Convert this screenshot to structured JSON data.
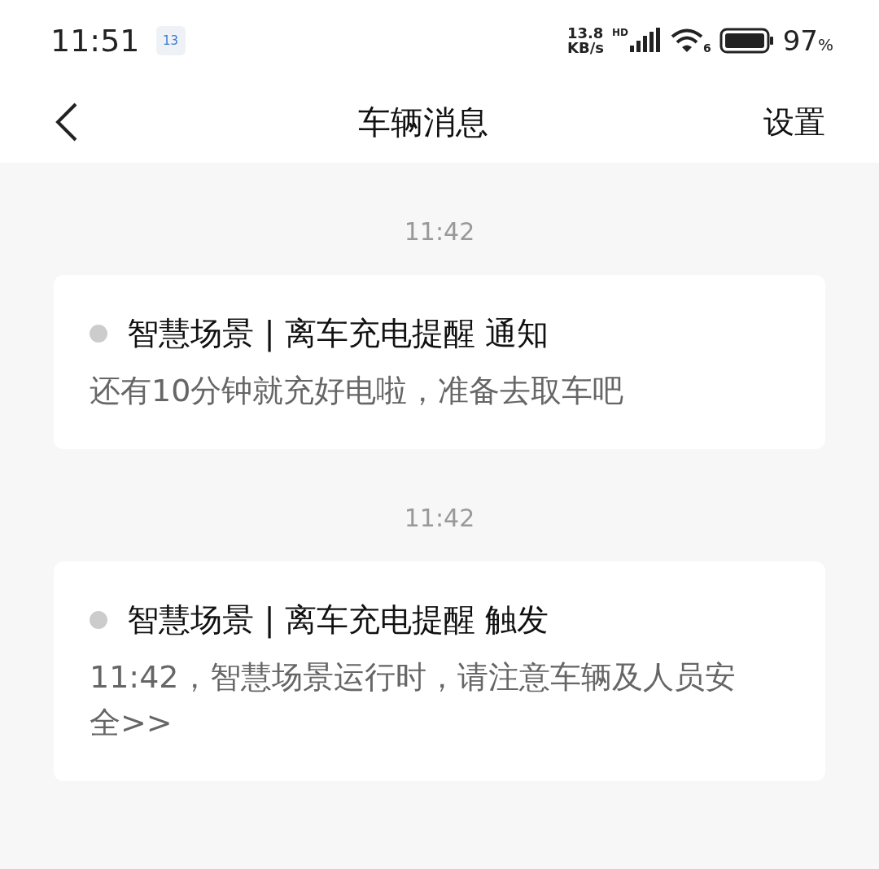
{
  "status_bar": {
    "time": "11:51",
    "calendar_day": "13",
    "net_speed_value": "13.8",
    "net_speed_unit": "KB/s",
    "signal_label": "HD",
    "wifi_label": "6",
    "battery": "97",
    "battery_unit": "%"
  },
  "header": {
    "title": "车辆消息",
    "action": "设置"
  },
  "messages": [
    {
      "time": "11:42",
      "title": "智慧场景 | 离车充电提醒 通知",
      "body": "还有10分钟就充好电啦，准备去取车吧"
    },
    {
      "time": "11:42",
      "title": "智慧场景 | 离车充电提醒 触发",
      "body": "11:42，智慧场景运行时，请注意车辆及人员安全>>"
    }
  ]
}
